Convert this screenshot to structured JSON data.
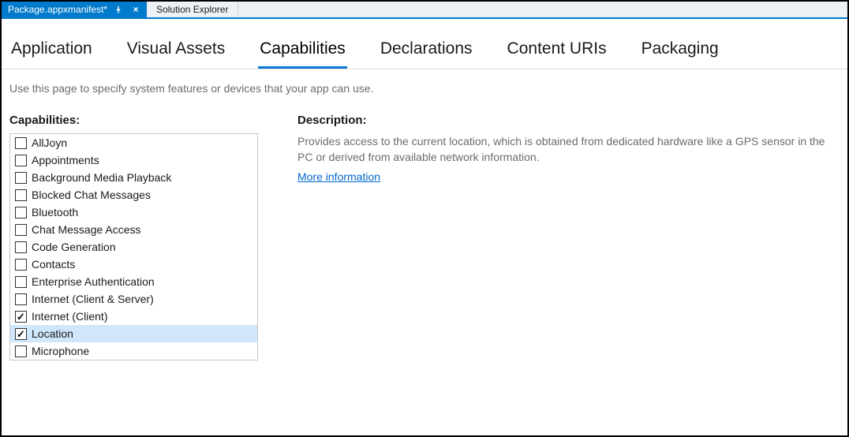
{
  "tabbar": {
    "active_doc": "Package.appxmanifest*",
    "tool_window": "Solution Explorer"
  },
  "nav": {
    "tabs": [
      {
        "label": "Application",
        "active": false
      },
      {
        "label": "Visual Assets",
        "active": false
      },
      {
        "label": "Capabilities",
        "active": true
      },
      {
        "label": "Declarations",
        "active": false
      },
      {
        "label": "Content URIs",
        "active": false
      },
      {
        "label": "Packaging",
        "active": false
      }
    ]
  },
  "help_text": "Use this page to specify system features or devices that your app can use.",
  "capabilities": {
    "heading": "Capabilities:",
    "items": [
      {
        "label": "AllJoyn",
        "checked": false,
        "selected": false
      },
      {
        "label": "Appointments",
        "checked": false,
        "selected": false
      },
      {
        "label": "Background Media Playback",
        "checked": false,
        "selected": false
      },
      {
        "label": "Blocked Chat Messages",
        "checked": false,
        "selected": false
      },
      {
        "label": "Bluetooth",
        "checked": false,
        "selected": false
      },
      {
        "label": "Chat Message Access",
        "checked": false,
        "selected": false
      },
      {
        "label": "Code Generation",
        "checked": false,
        "selected": false
      },
      {
        "label": "Contacts",
        "checked": false,
        "selected": false
      },
      {
        "label": "Enterprise Authentication",
        "checked": false,
        "selected": false
      },
      {
        "label": "Internet (Client & Server)",
        "checked": false,
        "selected": false
      },
      {
        "label": "Internet (Client)",
        "checked": true,
        "selected": false
      },
      {
        "label": "Location",
        "checked": true,
        "selected": true
      },
      {
        "label": "Microphone",
        "checked": false,
        "selected": false
      }
    ]
  },
  "description": {
    "heading": "Description:",
    "body": "Provides access to the current location, which is obtained from dedicated hardware like a GPS sensor in the PC or derived from available network information.",
    "link_label": "More information"
  }
}
